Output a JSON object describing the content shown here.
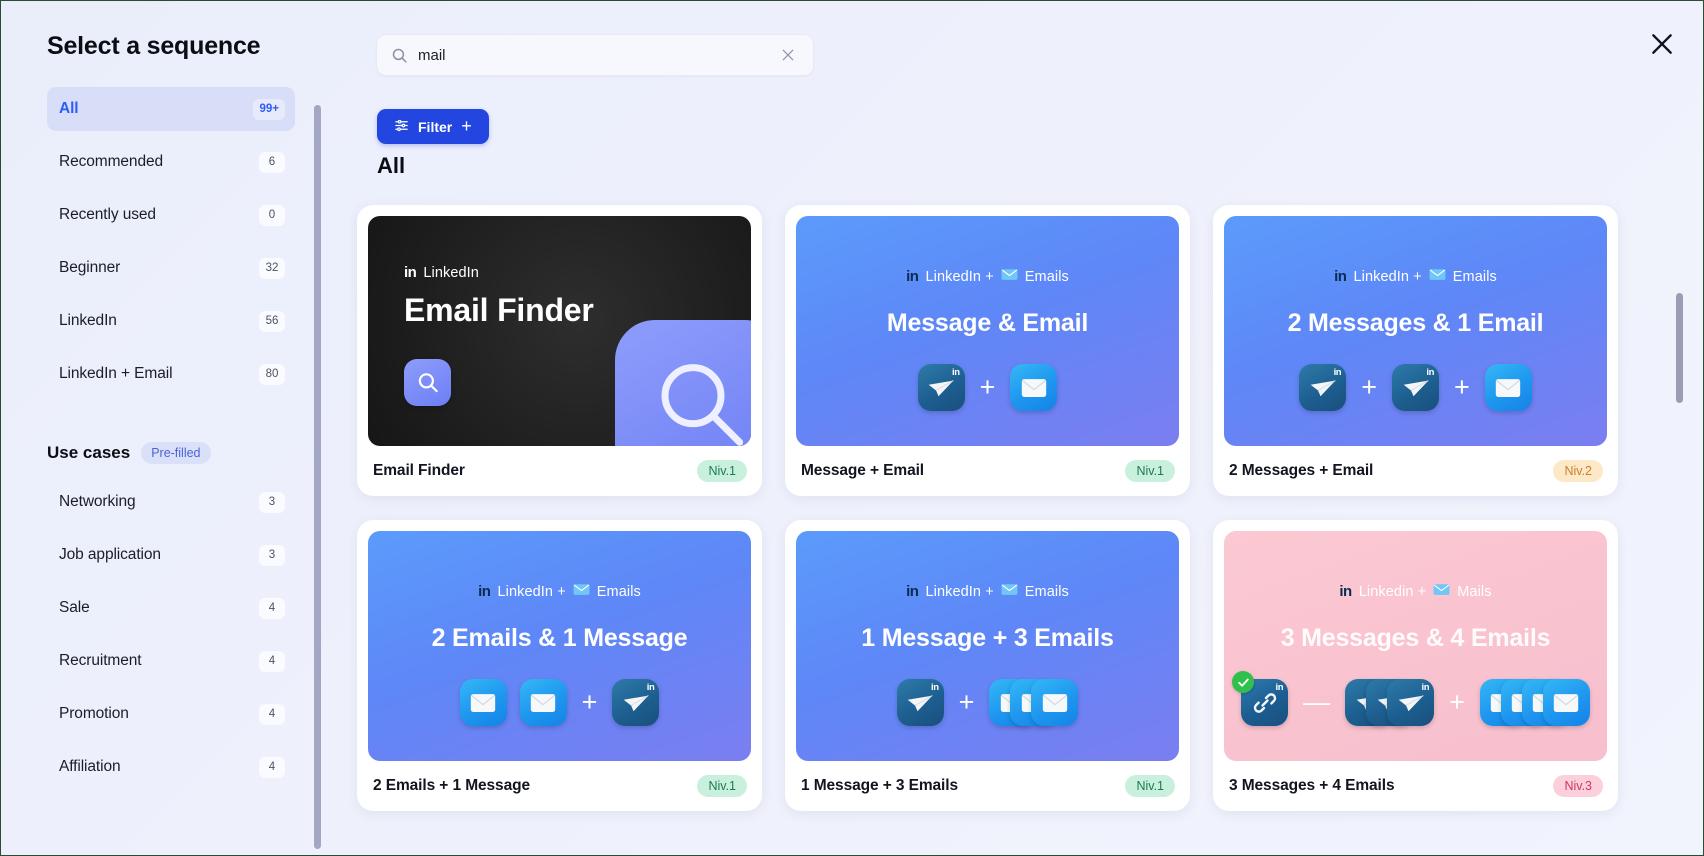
{
  "panel": {
    "title": "Select a sequence",
    "close_icon": "close-icon"
  },
  "search": {
    "value": "mail",
    "placeholder": "Search",
    "icon": "search-icon",
    "clear_icon": "close-icon"
  },
  "filter": {
    "label": "Filter",
    "icon": "sliders-icon",
    "plus": "+"
  },
  "results": {
    "heading": "All"
  },
  "sidebar": {
    "items": [
      {
        "label": "All",
        "count": "99+",
        "active": true
      },
      {
        "label": "Recommended",
        "count": "6",
        "active": false
      },
      {
        "label": "Recently used",
        "count": "0",
        "active": false
      },
      {
        "label": "Beginner",
        "count": "32",
        "active": false
      },
      {
        "label": "LinkedIn",
        "count": "56",
        "active": false
      },
      {
        "label": "LinkedIn + Email",
        "count": "80",
        "active": false
      }
    ],
    "usecases": {
      "title": "Use cases",
      "badge": "Pre-filled",
      "items": [
        {
          "label": "Networking",
          "count": "3"
        },
        {
          "label": "Job application",
          "count": "3"
        },
        {
          "label": "Sale",
          "count": "4"
        },
        {
          "label": "Recruitment",
          "count": "4"
        },
        {
          "label": "Promotion",
          "count": "4"
        },
        {
          "label": "Affiliation",
          "count": "4"
        }
      ]
    }
  },
  "cards": [
    {
      "art_style": "dark",
      "kicker_in": "in",
      "kicker_text": "LinkedIn",
      "kicker_mail_icon": "",
      "kicker_suffix": "",
      "art_title": "Email Finder",
      "icons": [],
      "name": "Email Finder",
      "level": "Niv.1",
      "level_class": "level-1"
    },
    {
      "art_style": "gradient-blue",
      "kicker_in": "in",
      "kicker_text": "LinkedIn +",
      "kicker_mail_icon": "envelope-icon",
      "kicker_suffix": "Emails",
      "art_title": "Message & Email",
      "icons": [
        {
          "type": "msg",
          "badge": "in"
        },
        {
          "type": "plus"
        },
        {
          "type": "mail",
          "badge": ""
        }
      ],
      "name": "Message + Email",
      "level": "Niv.1",
      "level_class": "level-1"
    },
    {
      "art_style": "gradient-blue",
      "kicker_in": "in",
      "kicker_text": "LinkedIn +",
      "kicker_mail_icon": "envelope-icon",
      "kicker_suffix": "Emails",
      "art_title": "2 Messages & 1 Email",
      "icons": [
        {
          "type": "msg",
          "badge": "in"
        },
        {
          "type": "plus"
        },
        {
          "type": "msg",
          "badge": "in"
        },
        {
          "type": "plus"
        },
        {
          "type": "mail",
          "badge": ""
        }
      ],
      "name": "2 Messages + Email",
      "level": "Niv.2",
      "level_class": "level-2"
    },
    {
      "art_style": "gradient-blue",
      "kicker_in": "in",
      "kicker_text": "LinkedIn +",
      "kicker_mail_icon": "envelope-icon",
      "kicker_suffix": "Emails",
      "art_title": "2 Emails & 1 Message",
      "icons": [
        {
          "type": "mail",
          "badge": ""
        },
        {
          "type": "mail",
          "badge": ""
        },
        {
          "type": "plus"
        },
        {
          "type": "msg",
          "badge": "in"
        }
      ],
      "name": "2 Emails + 1 Message",
      "level": "Niv.1",
      "level_class": "level-1"
    },
    {
      "art_style": "gradient-blue",
      "kicker_in": "in",
      "kicker_text": "LinkedIn +",
      "kicker_mail_icon": "envelope-icon",
      "kicker_suffix": "Emails",
      "art_title": "1 Message + 3 Emails",
      "icons": [
        {
          "type": "msg",
          "badge": "in"
        },
        {
          "type": "plus"
        },
        {
          "type": "mail-stack",
          "count": 3
        }
      ],
      "name": "1 Message + 3 Emails",
      "level": "Niv.1",
      "level_class": "level-1"
    },
    {
      "art_style": "pink",
      "kicker_in": "in",
      "kicker_text": "Linkedin +",
      "kicker_mail_icon": "envelope-icon",
      "kicker_suffix": "Mails",
      "art_title": "3 Messages & 4 Emails",
      "icons": [
        {
          "type": "link",
          "badge": "in",
          "check": true
        },
        {
          "type": "minus"
        },
        {
          "type": "msg-stack",
          "count": 3
        },
        {
          "type": "plus"
        },
        {
          "type": "mail-stack",
          "count": 4
        }
      ],
      "name": "3 Messages + 4 Emails",
      "level": "Niv.3",
      "level_class": "level-3"
    }
  ]
}
